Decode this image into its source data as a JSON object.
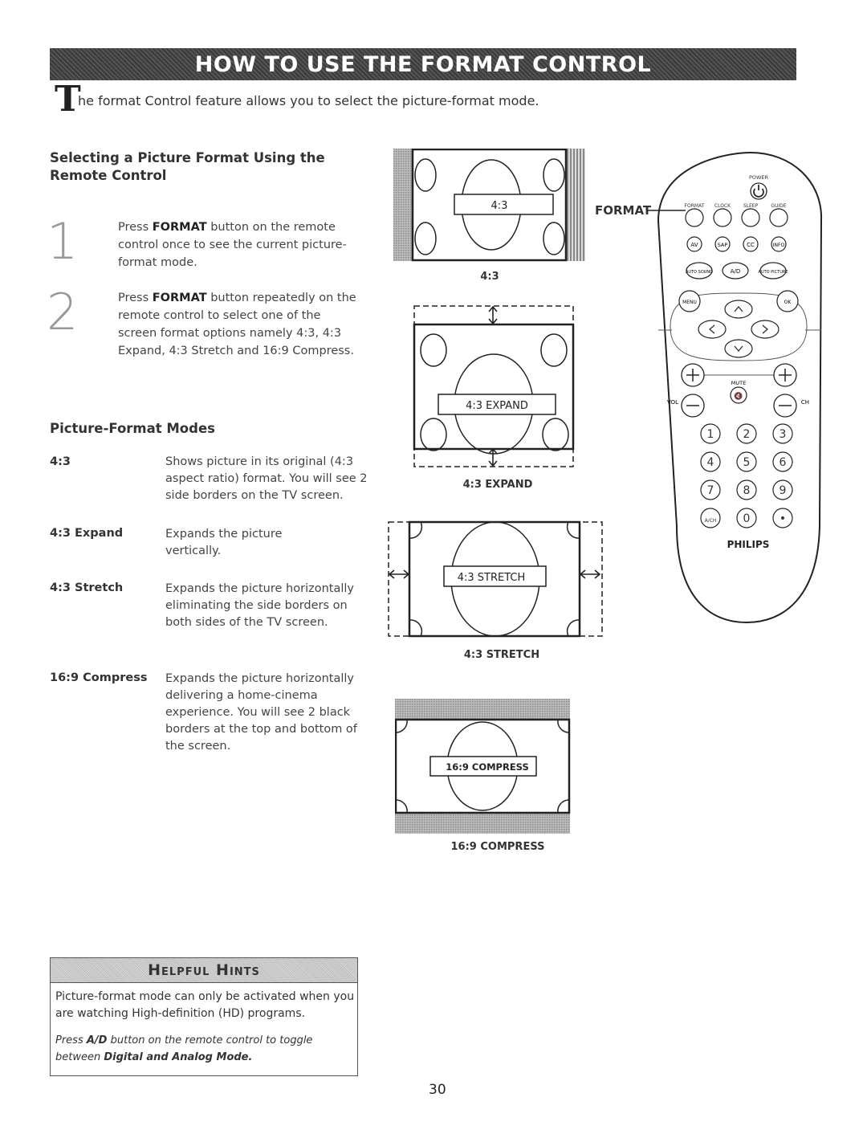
{
  "banner": {
    "title": "HOW TO USE THE FORMAT CONTROL"
  },
  "intro": {
    "drop_cap": "T",
    "text": "he format Control feature allows you to select the picture-format mode."
  },
  "section1": {
    "title_line1": "Selecting a Picture Format Using the",
    "title_line2": "Remote Control",
    "steps": [
      {
        "number": "1",
        "pre": "Press ",
        "bold": "FORMAT",
        "post": " button on the remote control once to see the current picture-format mode."
      },
      {
        "number": "2",
        "pre": "Press ",
        "bold": "FORMAT",
        "post": " button repeatedly on the remote control to select one of the screen format options namely 4:3, 4:3 Expand, 4:3 Stretch and 16:9 Compress."
      }
    ]
  },
  "section2": {
    "title": "Picture-Format Modes",
    "modes": [
      {
        "name": "4:3",
        "desc": "Shows picture in its original (4:3 aspect ratio) format. You will see 2 side borders on the TV screen."
      },
      {
        "name": "4:3 Expand",
        "desc": "Expands the picture vertically."
      },
      {
        "name": "4:3 Stretch",
        "desc": "Expands the picture horizontally eliminating the side borders on both sides of the TV screen."
      },
      {
        "name": "16:9 Compress",
        "desc": "Expands the picture horizontally delivering a home-cinema experience. You will see 2 black borders at the top and bottom of the screen."
      }
    ]
  },
  "diagrams": {
    "d43": {
      "label": "4:3",
      "caption": "4:3"
    },
    "d43expand": {
      "label": "4:3 EXPAND",
      "caption": "4:3 EXPAND"
    },
    "d43stretch": {
      "label": "4:3 STRETCH",
      "caption": "4:3 STRETCH"
    },
    "d169compress": {
      "label": "16:9 COMPRESS",
      "caption": "16:9 COMPRESS"
    }
  },
  "remote": {
    "callout": "FORMAT",
    "power_label": "POWER",
    "top_row": [
      "FORMAT",
      "CLOCK",
      "SLEEP",
      "GUIDE"
    ],
    "row2": [
      "AV",
      "SAP",
      "CC",
      "INFO"
    ],
    "row3": [
      "AUTO SOUND",
      "A/D",
      "AUTO PICTURE"
    ],
    "menu": "MENU",
    "ok": "OK",
    "mute": "MUTE",
    "vol": "VOL",
    "ch": "CH",
    "digits": [
      "1",
      "2",
      "3",
      "4",
      "5",
      "6",
      "7",
      "8",
      "9",
      "A/CH",
      "0",
      "•"
    ],
    "brand": "PHILIPS"
  },
  "hints": {
    "title": "Helpful Hints",
    "p1": "Picture-format mode can only be activated when you are watching High-definition (HD) programs.",
    "p2_pre": "Press ",
    "p2_bold1": "A/D",
    "p2_mid": " button on the remote control to toggle between ",
    "p2_bold2": "Digital and Analog Mode."
  },
  "page_number": "30"
}
